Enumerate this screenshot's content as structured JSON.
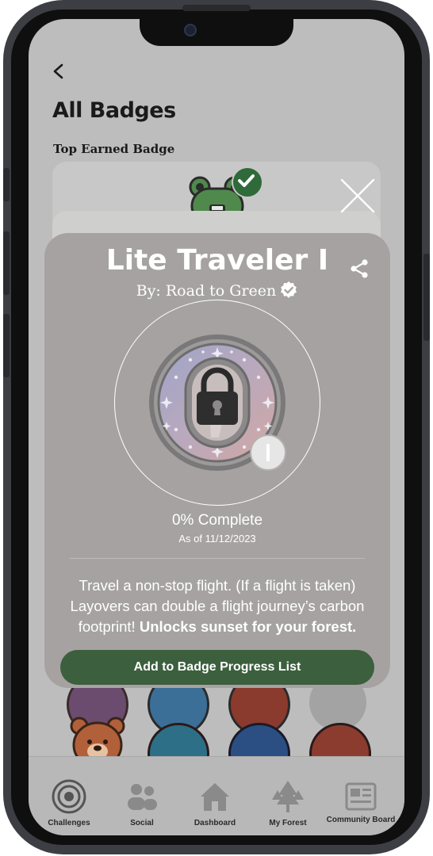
{
  "header": {
    "title": "All Badges",
    "subtitle": "Top Earned Badge"
  },
  "modal": {
    "title": "Lite Traveler I",
    "by_line": "By: Road to Green",
    "progress_text": "0% Complete",
    "progress_percent": 0,
    "as_of": "As of 11/12/2023",
    "description": "Travel a non-stop flight. (If a flight is taken) Layovers can double a flight journey’s carbon footprint!",
    "description_bold": "Unlocks sunset for your forest.",
    "button_label": "Add to Badge Progress List",
    "level_icon": "roman-numeral-one",
    "locked": true
  },
  "bottom_nav": [
    {
      "label": "Challenges",
      "icon": "target-icon"
    },
    {
      "label": "Social",
      "icon": "people-icon"
    },
    {
      "label": "Dashboard",
      "icon": "house-icon"
    },
    {
      "label": "My Forest",
      "icon": "trees-icon"
    },
    {
      "label": "Community Board",
      "icon": "board-icon"
    }
  ],
  "colors": {
    "accent": "#3c5f3d",
    "modal_bg": "#a6a2a2",
    "check": "#2e6a3a"
  }
}
